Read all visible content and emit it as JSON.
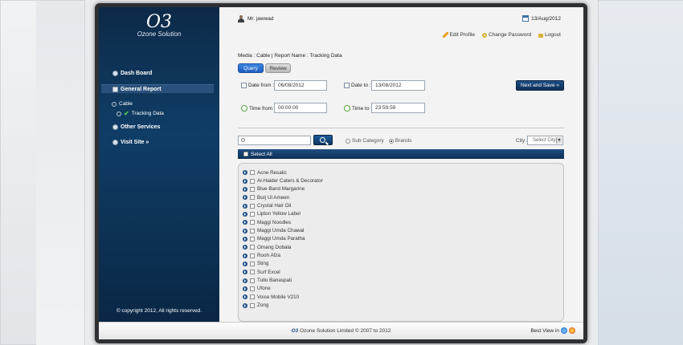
{
  "app": {
    "logo_mark": "O3",
    "logo_text": "Ozone Solution"
  },
  "sidebar": {
    "items": [
      {
        "label": "Dash Board"
      },
      {
        "label": "General Report"
      },
      {
        "label": "Other Services"
      },
      {
        "label": "Visit Site »"
      }
    ],
    "sub_cable": "Cable",
    "sub_tracking": "Tracking Data",
    "copyright": "© copyright 2012, All rights reserved."
  },
  "header": {
    "user": "Mr. jawwad",
    "date": "13/Aug/2012",
    "links": {
      "edit_profile": "Edit Profile",
      "change_password": "Change Password",
      "logout": "Logout"
    }
  },
  "breadcrumb": "Media : Cable | Report Name : Tracking Data",
  "tabs": [
    {
      "label": "Query"
    },
    {
      "label": "Review"
    }
  ],
  "filters": {
    "date_from_label": "Date from :",
    "date_from": "06/08/2012",
    "date_to_label": "Date to :",
    "date_to": "13/08/2012",
    "time_from_label": "Time from :",
    "time_from": "00:00:00",
    "time_to_label": "Time to :",
    "time_to": "23:59:59",
    "next_label": "Next and Save »"
  },
  "search": {
    "sub_category": "Sub Category",
    "brands": "Brands",
    "city_label": "City :",
    "city_value": "Select City"
  },
  "brands": {
    "select_all": "Select All",
    "items": [
      "Acne Resalic",
      "Al-Haider Caters & Decorator",
      "Blue Band Margarine",
      "Burj Ul Ameen",
      "Crystal Hair Oil",
      "Lipton Yellow Label",
      "Maggi Noodles",
      "Maggi Umda Chawal",
      "Maggi Umda Paratha",
      "Omang Dobala",
      "Rooh Afza",
      "Sting",
      "Surf Excel",
      "Tullo Banaspati",
      "Ufone",
      "Voice Mobile V210",
      "Zong"
    ]
  },
  "footer": {
    "brand": "O3",
    "text": "Ozone Solution Limited © 2007 to 2012",
    "best_view": "Best View in"
  },
  "colors": {
    "sidebar": "#0f3d66",
    "accent": "#1d5fc0",
    "bar": "#1f4e82"
  }
}
